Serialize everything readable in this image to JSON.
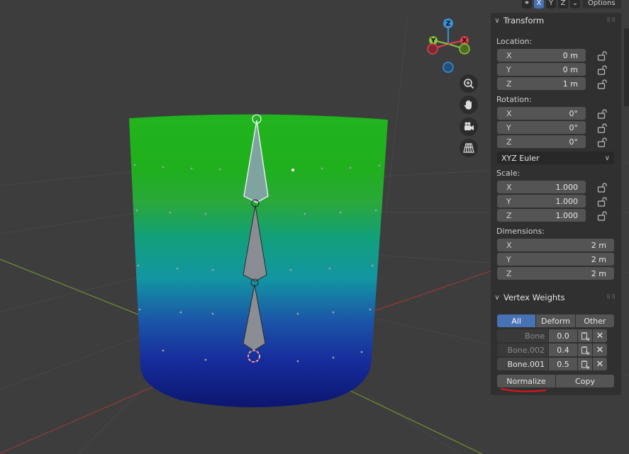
{
  "header": {
    "axis_buttons": [
      "X",
      "Y",
      "Z"
    ],
    "options_label": "Options"
  },
  "gizmo": {
    "z_label": "Z",
    "y_label": "Y",
    "x_label": "X",
    "colors": {
      "x": "#e2404c",
      "y": "#8bc33a",
      "z": "#3b8fd6"
    }
  },
  "transform": {
    "title": "Transform",
    "location_label": "Location:",
    "location": [
      {
        "axis": "X",
        "value": "0 m"
      },
      {
        "axis": "Y",
        "value": "0 m"
      },
      {
        "axis": "Z",
        "value": "1 m"
      }
    ],
    "rotation_label": "Rotation:",
    "rotation": [
      {
        "axis": "X",
        "value": "0°"
      },
      {
        "axis": "Y",
        "value": "0°"
      },
      {
        "axis": "Z",
        "value": "0°"
      }
    ],
    "rotation_mode": "XYZ Euler",
    "scale_label": "Scale:",
    "scale": [
      {
        "axis": "X",
        "value": "1.000"
      },
      {
        "axis": "Y",
        "value": "1.000"
      },
      {
        "axis": "Z",
        "value": "1.000"
      }
    ],
    "dimensions_label": "Dimensions:",
    "dimensions": [
      {
        "axis": "X",
        "value": "2 m"
      },
      {
        "axis": "Y",
        "value": "2 m"
      },
      {
        "axis": "Z",
        "value": "2 m"
      }
    ]
  },
  "vertex_weights": {
    "title": "Vertex Weights",
    "filters": [
      "All",
      "Deform",
      "Other"
    ],
    "rows": [
      {
        "name": "Bone",
        "value": "0.0"
      },
      {
        "name": "Bone.002",
        "value": "0.4"
      },
      {
        "name": "Bone.001",
        "value": "0.5"
      }
    ],
    "normalize_label": "Normalize",
    "copy_label": "Copy"
  }
}
